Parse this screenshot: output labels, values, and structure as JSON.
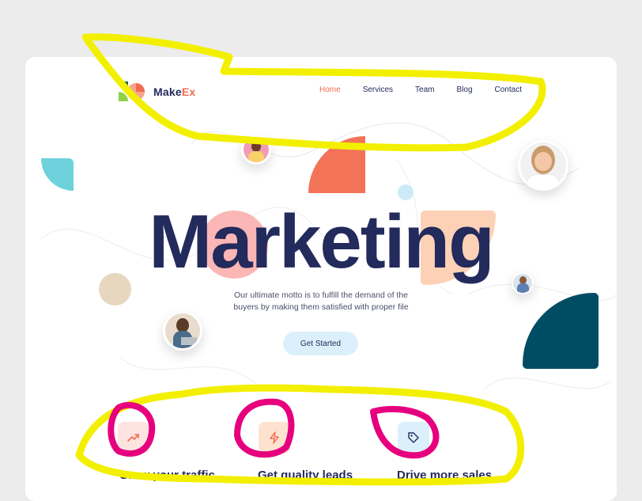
{
  "brand": {
    "name_prefix": "Make",
    "name_suffix": "Ex"
  },
  "nav": {
    "items": [
      "Home",
      "Services",
      "Team",
      "Blog",
      "Contact"
    ],
    "active": "Home"
  },
  "hero": {
    "title": "Marketing",
    "subtitle_line1": "Our ultimate motto is to fulfill the demand of the",
    "subtitle_line2": "buyers by making them satisfied with proper file",
    "cta_label": "Get Started"
  },
  "features": [
    {
      "label": "Grow your traffic",
      "icon": "trending-up-icon"
    },
    {
      "label": "Get quality leads",
      "icon": "lightning-icon"
    },
    {
      "label": "Drive more sales",
      "icon": "tag-icon"
    }
  ],
  "colors": {
    "navy": "#232a5c",
    "accent": "#f26b4f",
    "cyan": "#6dd2dc",
    "teal_dark": "#004d63",
    "peach": "#fdd1b6",
    "pink": "#fbb6b6",
    "beige": "#e8d7bf",
    "highlight_yellow": "#f3ef00",
    "highlight_magenta": "#e6007e"
  }
}
